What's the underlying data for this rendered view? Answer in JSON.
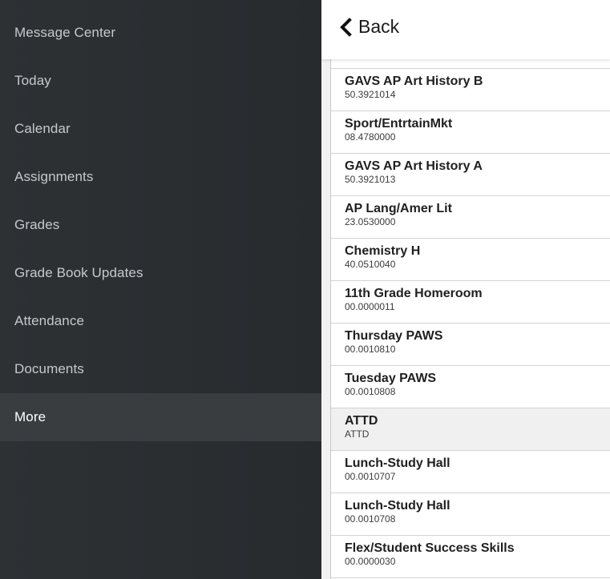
{
  "sidebar": {
    "items": [
      {
        "label": "Message Center",
        "active": false
      },
      {
        "label": "Today",
        "active": false
      },
      {
        "label": "Calendar",
        "active": false
      },
      {
        "label": "Assignments",
        "active": false
      },
      {
        "label": "Grades",
        "active": false
      },
      {
        "label": "Grade Book Updates",
        "active": false
      },
      {
        "label": "Attendance",
        "active": false
      },
      {
        "label": "Documents",
        "active": false
      },
      {
        "label": "More",
        "active": true
      }
    ]
  },
  "header": {
    "back_icon": "chevron-left-icon",
    "back_label": "Back"
  },
  "courses": [
    {
      "title": "GAVS AP Art History B",
      "code": "50.3921014"
    },
    {
      "title": "Sport/EntrtainMkt",
      "code": "08.4780000"
    },
    {
      "title": "GAVS AP Art History A",
      "code": "50.3921013"
    },
    {
      "title": "AP Lang/Amer Lit",
      "code": "23.0530000"
    },
    {
      "title": "Chemistry H",
      "code": "40.0510040"
    },
    {
      "title": "11th Grade Homeroom",
      "code": "00.0000011"
    },
    {
      "title": "Thursday PAWS",
      "code": "00.0010810"
    },
    {
      "title": "Tuesday PAWS",
      "code": "00.0010808"
    },
    {
      "title": "ATTD",
      "code": "ATTD"
    },
    {
      "title": "Lunch-Study Hall",
      "code": "00.0010707"
    },
    {
      "title": "Lunch-Study Hall",
      "code": "00.0010708"
    },
    {
      "title": "Flex/Student Success Skills",
      "code": "00.0000030"
    }
  ],
  "colors": {
    "sidebar_bg": "#2b2f32",
    "sidebar_active_bg": "#3a3d40",
    "sidebar_text": "#c7c9cb",
    "sidebar_active_text": "#ffffff",
    "row_highlight_bg": "#f0f0f0"
  }
}
